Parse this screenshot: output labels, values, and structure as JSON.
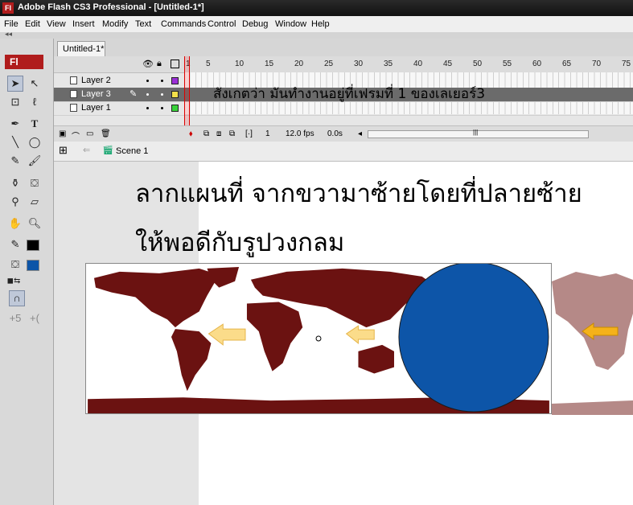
{
  "window": {
    "title": "Adobe Flash CS3 Professional - [Untitled-1*]",
    "logo": "Fl"
  },
  "menu": [
    "File",
    "Edit",
    "View",
    "Insert",
    "Modify",
    "Text",
    "Commands",
    "Control",
    "Debug",
    "Window",
    "Help"
  ],
  "document_tab": "Untitled-1*",
  "toolbar": {
    "badge": "Fl"
  },
  "timeline": {
    "frame_numbers": [
      "1",
      "5",
      "10",
      "15",
      "20",
      "25",
      "30",
      "35",
      "40",
      "45",
      "50",
      "55",
      "60",
      "65",
      "70",
      "75"
    ],
    "layers": [
      {
        "name": "Layer 2",
        "color": "#9b2fd6",
        "selected": false
      },
      {
        "name": "Layer 3",
        "color": "#f4e04a",
        "selected": true
      },
      {
        "name": "Layer 1",
        "color": "#39d23a",
        "selected": false
      }
    ],
    "current_frame": "1",
    "fps": "12.0 fps",
    "time": "0.0s"
  },
  "scene": "Scene 1",
  "annotations": {
    "timeline_note": "สังเกตว่า มันทำงานอยู่ที่เฟรมที่ 1 ของเลเยอร์3",
    "stage_line1": "ลากแผนที่ จากขวามาซ้ายโดยที่ปลายซ้าย",
    "stage_line2": "ให้พอดีกับรูปวงกลม"
  },
  "colors": {
    "map": "#6b1211",
    "map_faded": "#b58987",
    "circle": "#0d55a8",
    "arrow_light": "#fbdc8a",
    "arrow_strong": "#f5b21a"
  }
}
